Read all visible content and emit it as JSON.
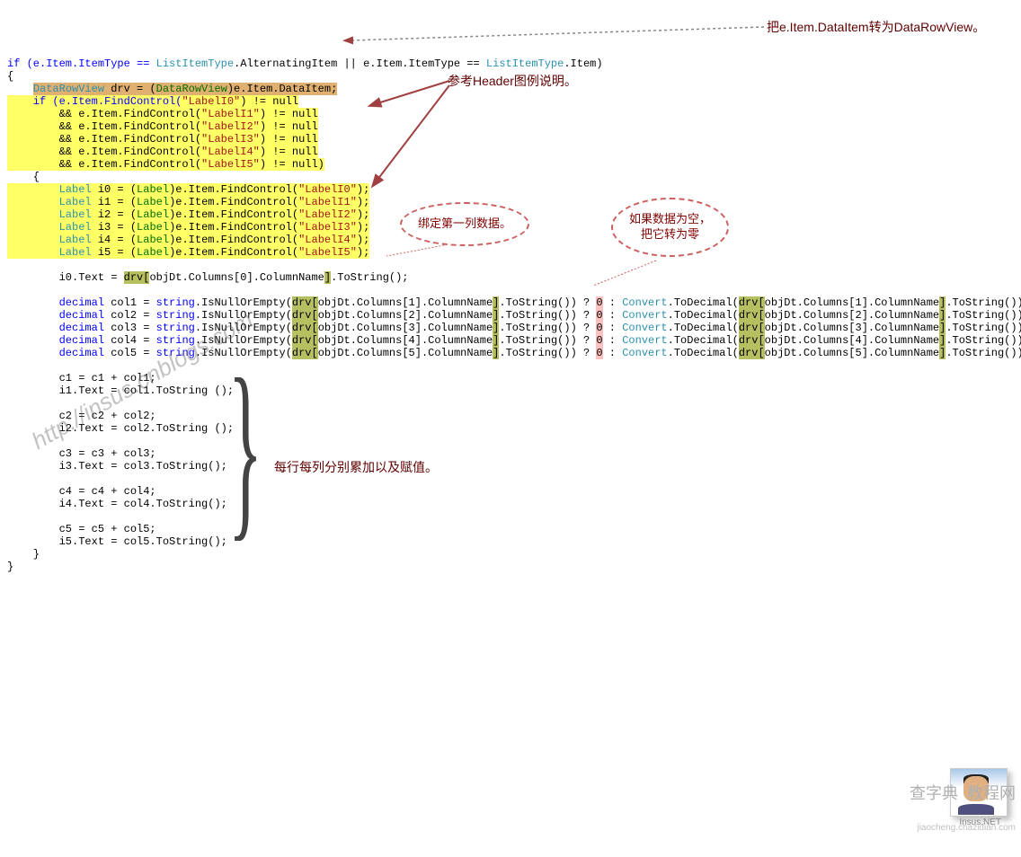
{
  "code": {
    "line1_pre": "if (e.Item.ItemType == ",
    "line1_t1": "ListItemType",
    "line1_m1": ".AlternatingItem || e.Item.ItemType == ",
    "line1_t2": "ListItemType",
    "line1_e": ".Item)",
    "drv_t1": "DataRowView",
    "drv_m1": " drv = (",
    "drv_t2": "DataRowView",
    "drv_e": ")e.Item.DataItem;",
    "fc0_a": "    if (e.Item.FindControl(",
    "fc0_s": "\"LabelI0\"",
    "fc0_e": ") != null",
    "fc1_a": "        && e.Item.FindControl(",
    "fc1_s": "\"LabelI1\"",
    "fc1_e": ") != null",
    "fc2_a": "        && e.Item.FindControl(",
    "fc2_s": "\"LabelI2\"",
    "fc2_e": ") != null",
    "fc3_a": "        && e.Item.FindControl(",
    "fc3_s": "\"LabelI3\"",
    "fc3_e": ") != null",
    "fc4_a": "        && e.Item.FindControl(",
    "fc4_s": "\"LabelI4\"",
    "fc4_e": ") != null",
    "fc5_a": "        && e.Item.FindControl(",
    "fc5_s": "\"LabelI5\"",
    "fc5_e": ") != null)",
    "lb0_a": "        ",
    "lb0_t": "Label",
    "lb0_m": " i0 = (",
    "lb0_t2": "Label",
    "lb0_f": ")e.Item.FindControl(",
    "lb0_s": "\"LabelI0\"",
    "lb0_e": ");",
    "lb1_a": "        ",
    "lb1_t": "Label",
    "lb1_m": " i1 = (",
    "lb1_t2": "Label",
    "lb1_f": ")e.Item.FindControl(",
    "lb1_s": "\"LabelI1\"",
    "lb1_e": ");",
    "lb2_a": "        ",
    "lb2_t": "Label",
    "lb2_m": " i2 = (",
    "lb2_t2": "Label",
    "lb2_f": ")e.Item.FindControl(",
    "lb2_s": "\"LabelI2\"",
    "lb2_e": ");",
    "lb3_a": "        ",
    "lb3_t": "Label",
    "lb3_m": " i3 = (",
    "lb3_t2": "Label",
    "lb3_f": ")e.Item.FindControl(",
    "lb3_s": "\"LabelI3\"",
    "lb3_e": ");",
    "lb4_a": "        ",
    "lb4_t": "Label",
    "lb4_m": " i4 = (",
    "lb4_t2": "Label",
    "lb4_f": ")e.Item.FindControl(",
    "lb4_s": "\"LabelI4\"",
    "lb4_e": ");",
    "lb5_a": "        ",
    "lb5_t": "Label",
    "lb5_m": " i5 = (",
    "lb5_t2": "Label",
    "lb5_f": ")e.Item.FindControl(",
    "lb5_s": "\"LabelI5\"",
    "lb5_e": ");",
    "i0text_a": "        i0.Text = ",
    "i0text_d": "drv[",
    "i0text_m": "objDt.Columns[0].ColumnName",
    "i0text_b": "]",
    "i0text_e": ".ToString();",
    "col_pre1": "        ",
    "col_kw": "decimal",
    "col_sp": " col",
    "col_eq": " = ",
    "col_kw2": "string",
    "col_m1": ".IsNullOrEmpty(",
    "col_d1": "drv[",
    "col_m2": "objDt.Columns[",
    "col_m3": "].ColumnName",
    "col_b1": "]",
    "col_m4": ".ToString()) ? ",
    "col_zero": "0",
    "col_m5": " : ",
    "col_cv": "Convert",
    "col_m6": ".ToDecimal(",
    "col_m7": ".ToString());",
    "idx1": "1",
    "idx2": "2",
    "idx3": "3",
    "idx4": "4",
    "idx5": "5",
    "c1a": "        c1 = c1 + col1;",
    "c1b": "        i1.Text = col1.ToString ();",
    "c2a": "        c2 = c2 + col2;",
    "c2b": "        i2.Text = col2.ToString ();",
    "c3a": "        c3 = c3 + col3;",
    "c3b": "        i3.Text = col3.ToString();",
    "c4a": "        c4 = c4 + col4;",
    "c4b": "        i4.Text = col4.ToString();",
    "c5a": "        c5 = c5 + col5;",
    "c5b": "        i5.Text = col5.ToString();",
    "ob": "{",
    "cb": "}",
    "ob4": "    {",
    "cb4": "    }",
    "cb8": "        }"
  },
  "annotations": {
    "a1": "把e.Item.DataItem转为DataRowView。",
    "a2": "参考Header图例说明。",
    "a3": "绑定第一列数据。",
    "a4": "如果数据为空，\n把它转为零",
    "a5": "每行每列分别累加以及赋值。"
  },
  "watermark": "http://insus.cnblogs.com",
  "avatar_label": "Insus.NET",
  "footer_main": "查字典  教程网",
  "footer_sub": "jiaocheng.chazidian.com"
}
